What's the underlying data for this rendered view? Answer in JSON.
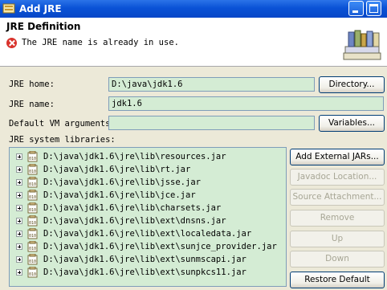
{
  "window": {
    "title": "Add JRE"
  },
  "header": {
    "title": "JRE Definition",
    "message": "The JRE name is already in use."
  },
  "form": {
    "jre_home_label": "JRE home:",
    "jre_home_value": "D:\\java\\jdk1.6",
    "directory_button": "Directory...",
    "jre_name_label": "JRE name:",
    "jre_name_value": "jdk1.6",
    "vm_args_label": "Default VM arguments:",
    "vm_args_value": "",
    "variables_button": "Variables...",
    "libraries_label": "JRE system libraries:"
  },
  "libraries": [
    "D:\\java\\jdk1.6\\jre\\lib\\resources.jar",
    "D:\\java\\jdk1.6\\jre\\lib\\rt.jar",
    "D:\\java\\jdk1.6\\jre\\lib\\jsse.jar",
    "D:\\java\\jdk1.6\\jre\\lib\\jce.jar",
    "D:\\java\\jdk1.6\\jre\\lib\\charsets.jar",
    "D:\\java\\jdk1.6\\jre\\lib\\ext\\dnsns.jar",
    "D:\\java\\jdk1.6\\jre\\lib\\ext\\localedata.jar",
    "D:\\java\\jdk1.6\\jre\\lib\\ext\\sunjce_provider.jar",
    "D:\\java\\jdk1.6\\jre\\lib\\ext\\sunmscapi.jar",
    "D:\\java\\jdk1.6\\jre\\lib\\ext\\sunpkcs11.jar"
  ],
  "side_buttons": {
    "add_external_jars": "Add External JARs...",
    "javadoc_location": "Javadoc Location...",
    "source_attachment": "Source Attachment...",
    "remove": "Remove",
    "up": "Up",
    "down": "Down",
    "restore_default": "Restore Default"
  },
  "icons": {
    "error": "error-icon",
    "header_graphic": "library-books-icon",
    "library_entry": "jar-icon"
  },
  "colors": {
    "titlebar": "#0a52d6",
    "field_bg": "#d4ecd4",
    "error": "#d9332c"
  }
}
